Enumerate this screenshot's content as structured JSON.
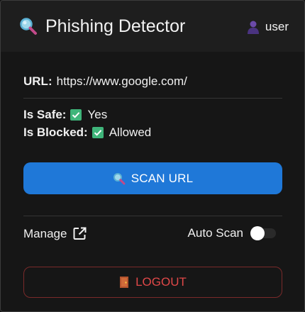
{
  "header": {
    "title": "Phishing Detector",
    "app_icon": "magnifier-icon",
    "user_icon": "user-silhouette-icon",
    "user_name": "user"
  },
  "status": {
    "url_label": "URL:",
    "url_value": "https://www.google.com/",
    "is_safe_label": "Is Safe:",
    "is_safe_value": "Yes",
    "is_blocked_label": "Is Blocked:",
    "is_blocked_value": "Allowed",
    "check_icon": "check-box-icon"
  },
  "actions": {
    "scan_label": "SCAN URL",
    "scan_icon": "magnifier-icon",
    "manage_label": "Manage",
    "manage_icon": "external-link-icon",
    "auto_scan_label": "Auto Scan",
    "auto_scan_enabled": false,
    "logout_label": "LOGOUT",
    "logout_icon": "door-icon"
  },
  "colors": {
    "background": "#161616",
    "header": "#1e1e1e",
    "primary_button": "#1f78d8",
    "check_green": "#3fb57a",
    "logout_red": "#e04848",
    "logout_border": "#7a2a2a"
  }
}
